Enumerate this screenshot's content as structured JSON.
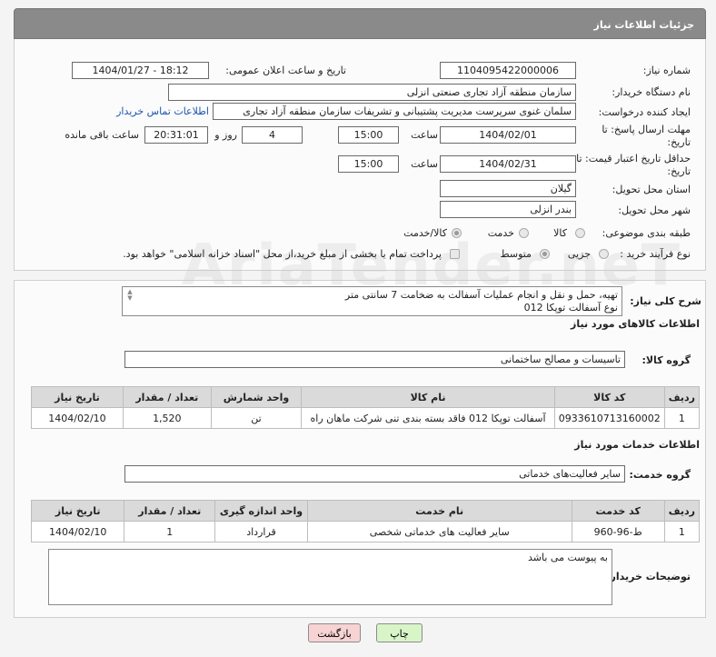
{
  "header": {
    "title": "جزئیات اطلاعات نیاز"
  },
  "form": {
    "need_number_label": "شماره نیاز:",
    "need_number": "1104095422000006",
    "announce_label": "تاریخ و ساعت اعلان عمومی:",
    "announce_value": "1404/01/27 - 18:12",
    "buyer_org_label": "نام دستگاه خریدار:",
    "buyer_org": "سازمان منطقه آزاد تجاری  صنعتی انزلی",
    "creator_label": "ایجاد کننده درخواست:",
    "creator": "سلمان غنوی سرپرست مدیریت پشتیبانی و تشریفات سازمان منطقه آزاد تجاری",
    "contact_link": "اطلاعات تماس خریدار",
    "send_deadline_label": "مهلت ارسال پاسخ: تا تاریخ:",
    "send_date": "1404/02/01",
    "time_label": "ساعت",
    "send_time": "15:00",
    "days_value": "4",
    "days_label": "روز و",
    "remaining_time": "20:31:01",
    "remaining_label": "ساعت باقی مانده",
    "validity_label": "حداقل تاریخ اعتبار قیمت: تا تاریخ:",
    "validity_date": "1404/02/31",
    "validity_time": "15:00",
    "province_label": "استان محل تحویل:",
    "province": "گیلان",
    "city_label": "شهر محل تحویل:",
    "city": "بندر انزلی",
    "category_label": "طبقه بندی موضوعی:",
    "category_options": [
      "کالا",
      "خدمت",
      "کالا/خدمت"
    ],
    "process_label": "نوع فرآیند خرید :",
    "process_options": [
      "جزیی",
      "متوسط"
    ],
    "payment_note": "پرداخت تمام یا بخشی از مبلغ خرید،از محل \"اسناد خزانه اسلامی\" خواهد بود."
  },
  "description": {
    "label": "شرح کلی نیاز:",
    "line1": "تهیه، حمل و نقل و انجام عملیات آسفالت به ضخامت 7 سانتی متر",
    "line2": "نوع آسفالت  توپکا 012"
  },
  "goods": {
    "section_title": "اطلاعات کالاهای مورد نیاز",
    "group_label": "گروه کالا:",
    "group_value": "تاسیسات و مصالح ساختمانی",
    "columns": [
      "ردیف",
      "کد کالا",
      "نام کالا",
      "واحد شمارش",
      "تعداد / مقدار",
      "تاریخ نیاز"
    ],
    "rows": [
      [
        "1",
        "0933610713160002",
        "آسفالت توپکا 012 فاقد بسته بندی تنی شرکت ماهان راه",
        "تن",
        "1,520",
        "1404/02/10"
      ]
    ]
  },
  "services": {
    "section_title": "اطلاعات خدمات مورد نیاز",
    "group_label": "گروه خدمت:",
    "group_value": "سایر فعالیت‌های خدماتی",
    "columns": [
      "ردیف",
      "کد خدمت",
      "نام خدمت",
      "واحد اندازه گیری",
      "تعداد / مقدار",
      "تاریخ نیاز"
    ],
    "rows": [
      [
        "1",
        "ط-96-960",
        "سایر فعالیت های خدماتی شخصی",
        "قرارداد",
        "1",
        "1404/02/10"
      ]
    ]
  },
  "buyer_notes": {
    "label": "توضیحات خریدار:",
    "text": "به پیوست می باشد"
  },
  "buttons": {
    "print": "چاپ",
    "back": "بازگشت"
  },
  "watermark": "AriaTender.neT",
  "colors": {
    "header_bg": "#8a8a8a",
    "link": "#1a56b0",
    "print_btn": "#d8f5c8",
    "back_btn": "#f7d3d3"
  }
}
